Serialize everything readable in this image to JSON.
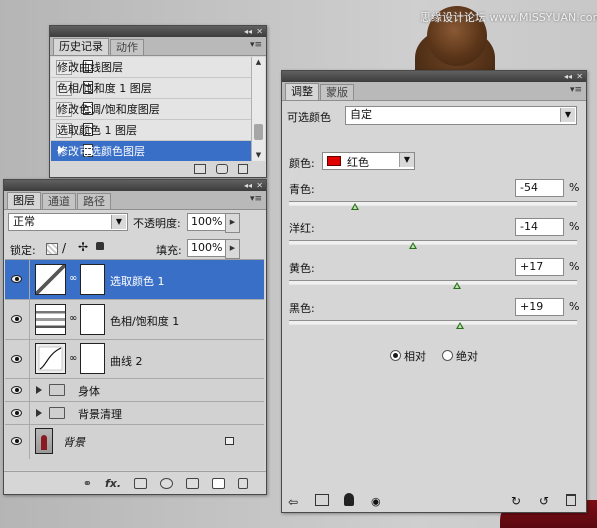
{
  "watermark": "思缘设计论坛 www.MISSYUAN.com",
  "history_panel": {
    "tabs": [
      "历史记录",
      "动作"
    ],
    "items": [
      {
        "label": "修改曲线图层"
      },
      {
        "label": "色相/饱和度 1 图层"
      },
      {
        "label": "修改色调/饱和度图层"
      },
      {
        "label": "选取颜色 1 图层"
      },
      {
        "label": "修改可选颜色图层",
        "selected": true
      }
    ]
  },
  "layers_panel": {
    "tabs": [
      "图层",
      "通道",
      "路径"
    ],
    "blend_mode": "正常",
    "opacity_label": "不透明度:",
    "opacity_value": "100%",
    "lock_label": "锁定:",
    "fill_label": "填充:",
    "fill_value": "100%",
    "layers": [
      {
        "name": "选取颜色 1",
        "type": "adjustment-selective-color",
        "selected": true
      },
      {
        "name": "色相/饱和度 1",
        "type": "adjustment-hue-saturation"
      },
      {
        "name": "曲线 2",
        "type": "adjustment-curves"
      },
      {
        "name": "身体",
        "type": "group"
      },
      {
        "name": "背景清理",
        "type": "group"
      },
      {
        "name": "背景",
        "type": "background",
        "locked": true
      }
    ],
    "footer_icons": [
      "link-icon",
      "fx-icon",
      "mask-icon",
      "adjustment-icon",
      "folder-icon",
      "new-layer-icon",
      "trash-icon"
    ]
  },
  "adjust_panel": {
    "tabs": [
      "调整",
      "蒙版"
    ],
    "title": "可选颜色",
    "preset_value": "自定",
    "colors_label": "颜色:",
    "color_value": "红色",
    "color_hex": "#e00000",
    "sliders": [
      {
        "label": "青色:",
        "value": "-54",
        "level": -54
      },
      {
        "label": "洋红:",
        "value": "-14",
        "level": -14
      },
      {
        "label": "黄色:",
        "value": "+17",
        "level": 17
      },
      {
        "label": "黑色:",
        "value": "+19",
        "level": 19
      }
    ],
    "percent": "%",
    "method_relative": "相对",
    "method_absolute": "绝对",
    "method_selected": "relative"
  },
  "accent_color": "#3a6fc7"
}
